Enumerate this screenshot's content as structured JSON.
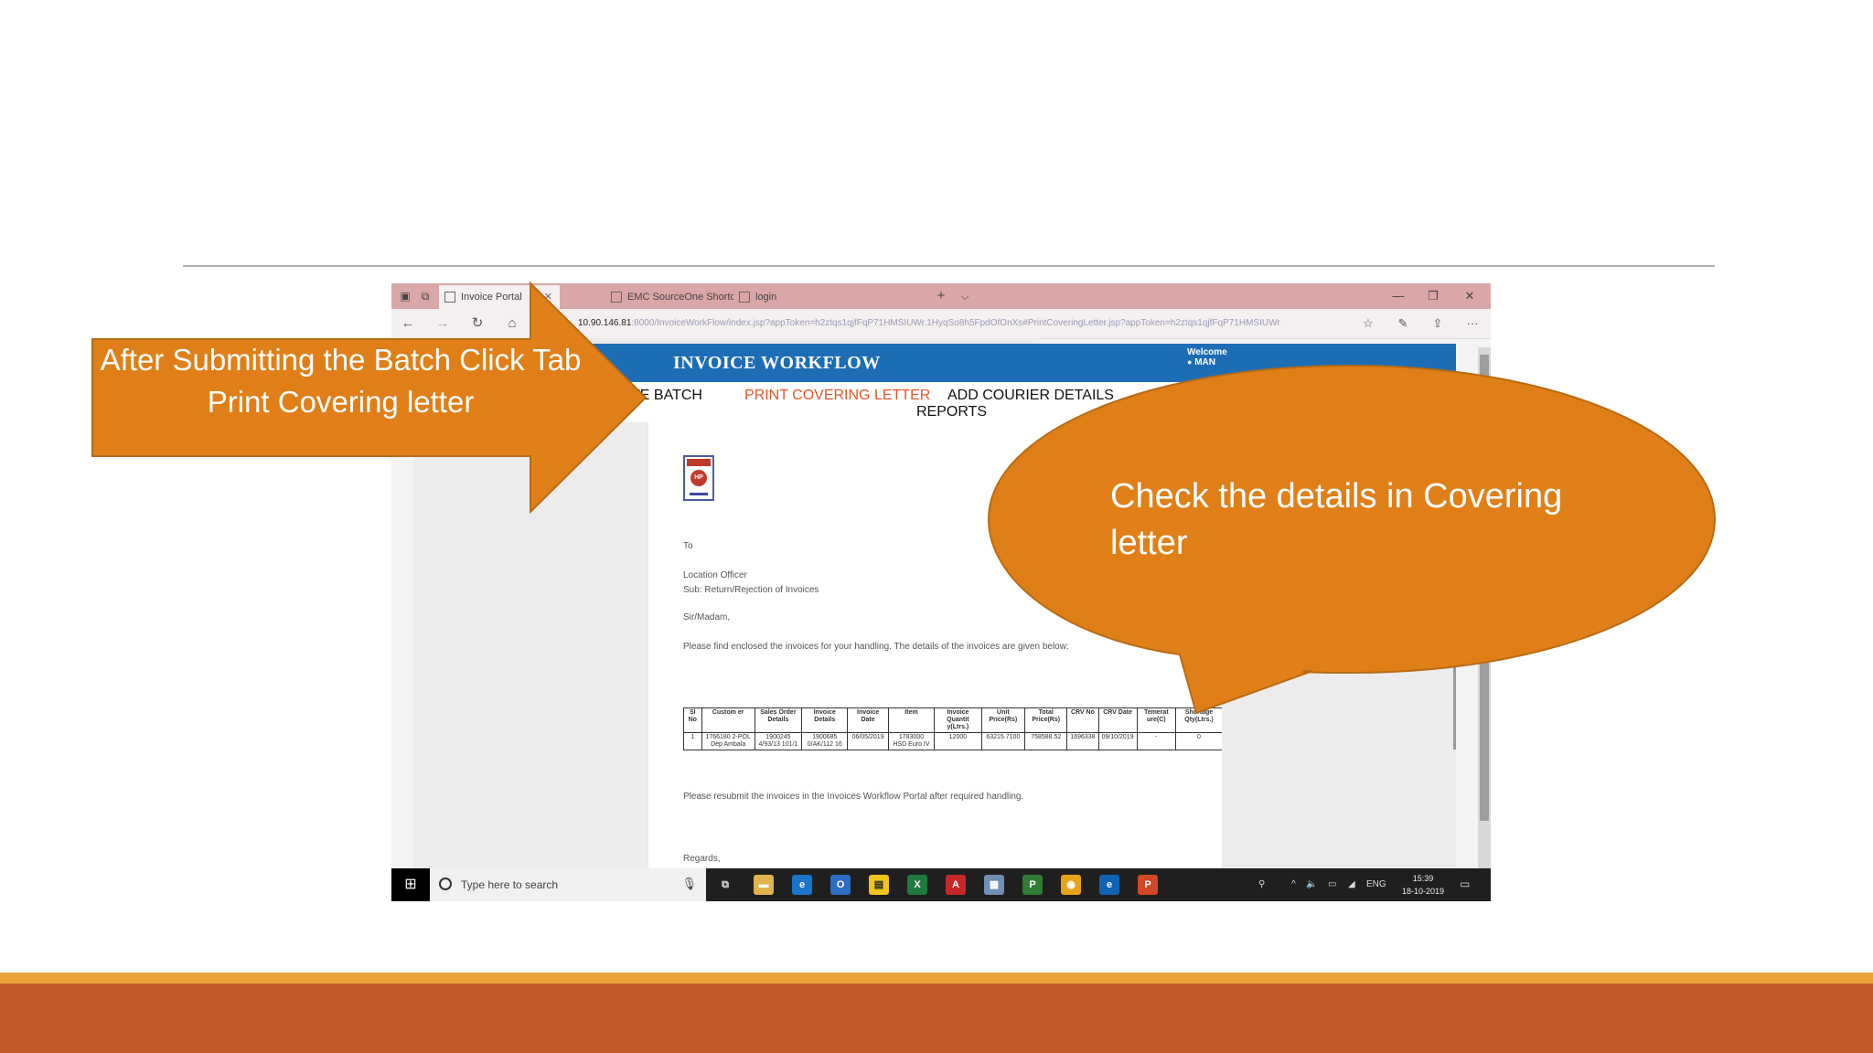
{
  "browser": {
    "tabs": [
      {
        "label": "Invoice Portal",
        "active": true
      },
      {
        "label": "EMC SourceOne Shortcut Ir",
        "active": false
      },
      {
        "label": "login",
        "active": false
      }
    ],
    "url_host": "10.90.146.81",
    "url_rest": ":8000/InvoiceWorkFlow/index.jsp?appToken=h2ztqs1qjfFqP71HMSIUWr.1HyqSo8h5FpdOfOnXs#PrintCoveringLetter.jsp?appToken=h2ztqs1qjfFqP71HMSIUWr"
  },
  "app": {
    "title": "INVOICE WORKFLOW",
    "welcome": "Welcome",
    "user": "MAN",
    "nav": {
      "create_batch": "TE BATCH",
      "print_covering_letter": "PRINT COVERING LETTER",
      "add_courier_details": "ADD COURIER DETAILS",
      "reports": "REPORTS"
    }
  },
  "letter": {
    "logo_text": "HP",
    "to": "To",
    "location_officer": "Location Officer",
    "subject": "Sub: Return/Rejection of Invoices",
    "salutation": "Sir/Madam,",
    "intro": "Please find enclosed the invoices for your handling. The details of the invoices are given below:",
    "table": {
      "headers": [
        "Sl No",
        "Custom er",
        "Sales Order Details",
        "Invoice Details",
        "Invoice Date",
        "Item",
        "Invoice Quantit y(Ltrs.)",
        "Unit Price(Rs)",
        "Total Price(Rs)",
        "CRV No",
        "CRV Date",
        "Temerat ure(C)",
        "Shortage Qty(Ltrs.)"
      ],
      "rows": [
        [
          "1",
          "1766180 2-POL Dep Ambala",
          "1900245 4/93/13 101/1",
          "1900685 0/AK/112 16",
          "06/05/2019",
          "1783000 HSD Euro IV",
          "12000",
          "63215.7100",
          "758588.52",
          "1696338",
          "09/10/2019",
          "-",
          "0"
        ]
      ]
    },
    "resubmit": "Please resubmit the invoices in the Invoices Workflow Portal after required handling.",
    "regards": "Regards,"
  },
  "taskbar": {
    "search_placeholder": "Type here to search",
    "lang": "ENG",
    "time": "15:39",
    "date": "18-10-2019"
  },
  "callouts": {
    "arrow_text": "After Submitting the Batch Click Tab Print Covering letter",
    "bubble_text": "Check the details in Covering letter"
  },
  "colors": {
    "callout_fill": "#e07f18",
    "callout_stroke": "#b86a14",
    "header_blue": "#1d6db5",
    "active_nav": "#e8532a",
    "bottom_band": "#bf5a28"
  }
}
